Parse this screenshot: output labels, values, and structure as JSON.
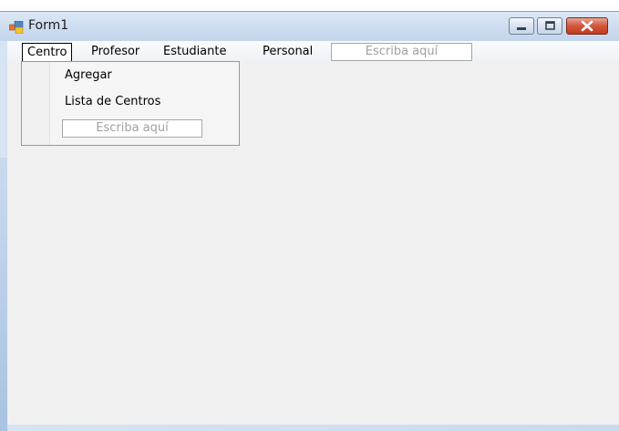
{
  "window": {
    "title": "Form1"
  },
  "colors": {
    "titlebar": "#cddcf0",
    "client": "#f0f0f0",
    "close_button": "#c23a1f"
  },
  "menubar": {
    "items": [
      {
        "label": "Centro"
      },
      {
        "label": "Profesor"
      },
      {
        "label": "Estudiante"
      },
      {
        "label": "Personal"
      }
    ],
    "type_here": "Escriba aquí"
  },
  "dropdown": {
    "items": [
      {
        "label": "Agregar"
      },
      {
        "label": "Lista de Centros"
      }
    ],
    "type_here": "Escriba aquí"
  },
  "icons": {
    "app": "form-app-icon",
    "minimize": "minimize-icon",
    "maximize": "maximize-icon",
    "close": "close-icon"
  }
}
